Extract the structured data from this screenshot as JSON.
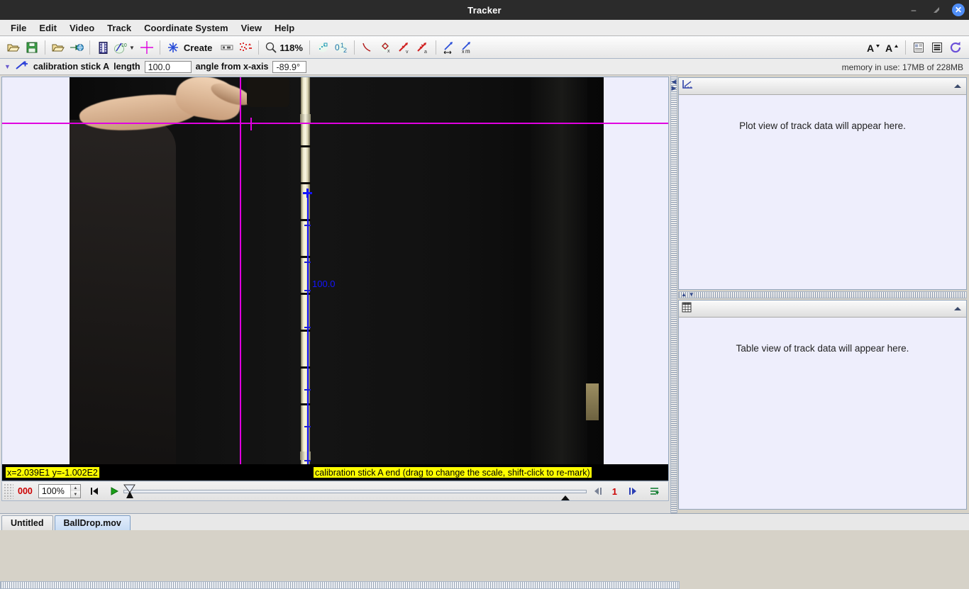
{
  "window": {
    "title": "Tracker",
    "minimize_icon": "minimize-icon",
    "maximize_icon": "maximize-icon",
    "close_icon": "close-icon"
  },
  "menu": {
    "items": [
      {
        "label": "File"
      },
      {
        "label": "Edit"
      },
      {
        "label": "Video"
      },
      {
        "label": "Track"
      },
      {
        "label": "Coordinate System"
      },
      {
        "label": "View"
      },
      {
        "label": "Help"
      }
    ]
  },
  "toolbar": {
    "open_label": "open-folder-icon",
    "save_label": "save-disk-icon",
    "open_library_label": "open-library-icon",
    "export_label": "export-to-web-icon",
    "video_filter_label": "film-strip-icon",
    "track_control_label": "track-control-icon",
    "axes_label": "axes-icon",
    "create_label": "Create",
    "create_icon": "asterisk-icon",
    "tape_icon": "tape-measure-icon",
    "calibration_points_icon": "calibration-points-icon",
    "zoom_icon": "magnifier-icon",
    "zoom_value": "118%",
    "autotracker_icon": "autotracker-icon",
    "frame_numbers_icon": "frame-number-icon",
    "trail_icon": "trail-curve-icon",
    "position_vector_icon": "position-vector-icon",
    "velocity_vector_icon": "velocity-vector-icon",
    "acceleration_vector_icon": "acceleration-vector-icon",
    "stretch_vector_icon": "stretch-vector-icon",
    "stretch_vector_m_icon": "stretch-vector-mass-icon",
    "font_smaller_icon": "font-decrease-icon",
    "font_larger_icon": "font-increase-icon",
    "notes_icon": "notes-icon",
    "data_builder_icon": "data-builder-icon",
    "refresh_icon": "refresh-icon"
  },
  "trackbar": {
    "collapse_icon": "triangle-down-icon",
    "track_icon": "calibration-stick-icon",
    "track_name": "calibration stick A",
    "length_label": "length",
    "length_value": "100.0",
    "angle_label": "angle from x-axis",
    "angle_value": "-89.9°",
    "memory": "memory in use: 17MB of 228MB"
  },
  "video": {
    "coord_readout": "x=2.039E1  y=-1.002E2",
    "hint_tip": "calibration stick A end (drag to change the scale, shift-click to re-mark)",
    "calibration_length_label": "100.0",
    "axis_color": "#e000e0",
    "calibration_color": "#1414ff"
  },
  "player": {
    "frame_number": "000",
    "rate_value": "100%",
    "rate_up_icon": "spinner-up-icon",
    "rate_down_icon": "spinner-down-icon",
    "step_to_start_icon": "skip-to-start-icon",
    "play_icon": "play-icon",
    "slider_thumb_icon": "slider-thumb-icon",
    "step_back_icon": "step-back-icon",
    "step_size": "1",
    "step_forward_icon": "step-forward-icon",
    "loop_icon": "loop-icon"
  },
  "plot_view": {
    "icon": "plot-view-icon",
    "collapse_icon": "collapse-triangle-icon",
    "placeholder": "Plot view of track data will appear here."
  },
  "table_view": {
    "icon": "table-view-icon",
    "collapse_icon": "collapse-triangle-icon",
    "placeholder": "Table view of track data will appear here."
  },
  "splitters": {
    "vertical_up_icon": "splitter-left-icon",
    "vertical_down_icon": "splitter-right-icon",
    "horizontal_up_icon": "splitter-up-icon",
    "horizontal_down_icon": "splitter-down-icon"
  },
  "tabs": [
    {
      "label": "Untitled",
      "active": false
    },
    {
      "label": "BallDrop.mov",
      "active": true
    }
  ]
}
